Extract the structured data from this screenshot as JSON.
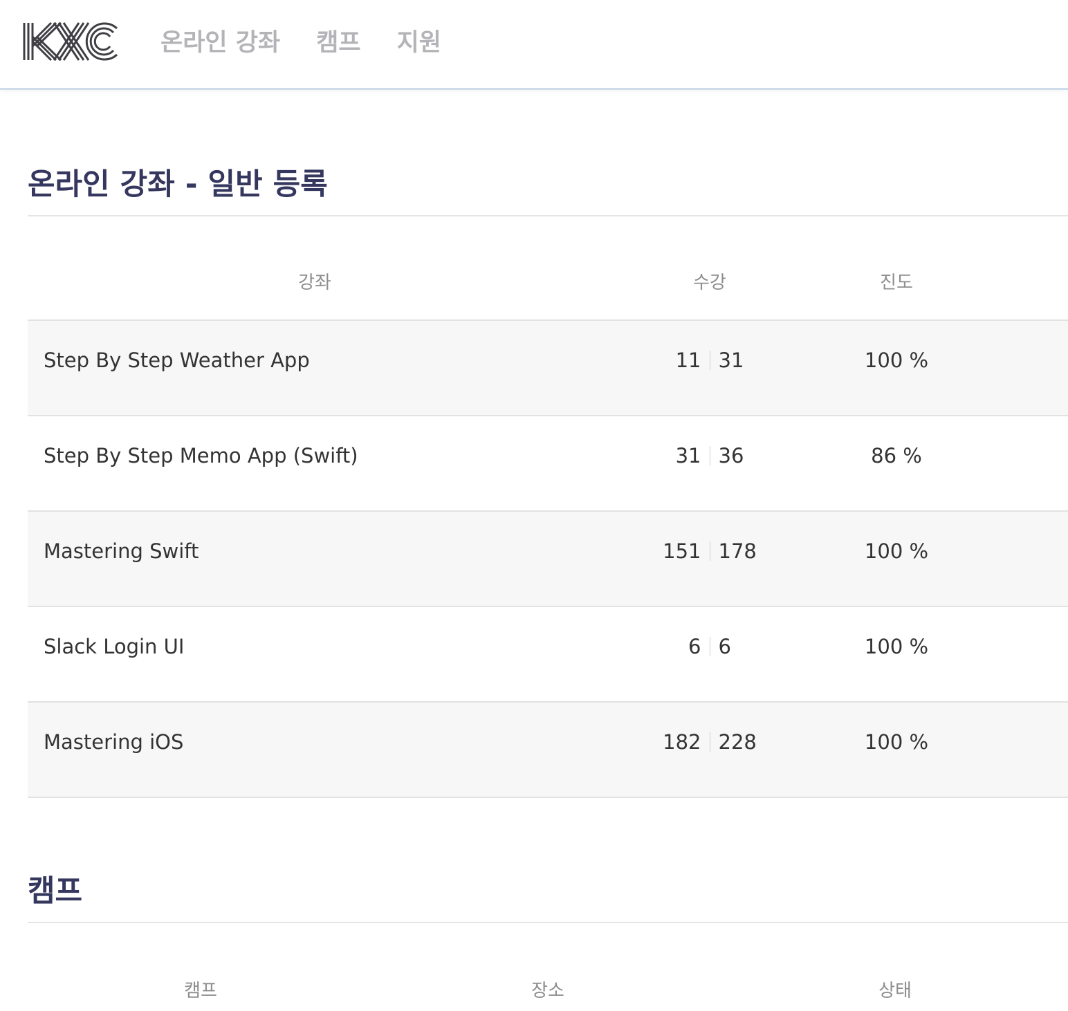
{
  "header": {
    "logo_text": "KXC",
    "nav": [
      {
        "label": "온라인 강좌"
      },
      {
        "label": "캠프"
      },
      {
        "label": "지원"
      }
    ]
  },
  "courses_section": {
    "title": "온라인 강좌 - 일반 등록",
    "columns": {
      "course": "강좌",
      "lessons": "수강",
      "progress": "진도"
    },
    "rows": [
      {
        "title": "Step By Step Weather App",
        "completed": "11",
        "total": "31",
        "progress": "100 %"
      },
      {
        "title": "Step By Step Memo App (Swift)",
        "completed": "31",
        "total": "36",
        "progress": "86 %"
      },
      {
        "title": "Mastering Swift",
        "completed": "151",
        "total": "178",
        "progress": "100 %"
      },
      {
        "title": "Slack Login UI",
        "completed": "6",
        "total": "6",
        "progress": "100 %"
      },
      {
        "title": "Mastering iOS",
        "completed": "182",
        "total": "228",
        "progress": "100 %"
      }
    ]
  },
  "camps_section": {
    "title": "캠프",
    "columns": {
      "camp": "캠프",
      "location": "장소",
      "status": "상태"
    }
  },
  "colors": {
    "title": "#35375f",
    "nav": "#b4b4b8",
    "row_shade": "#f7f7f7",
    "header_border": "#cfdcec"
  }
}
